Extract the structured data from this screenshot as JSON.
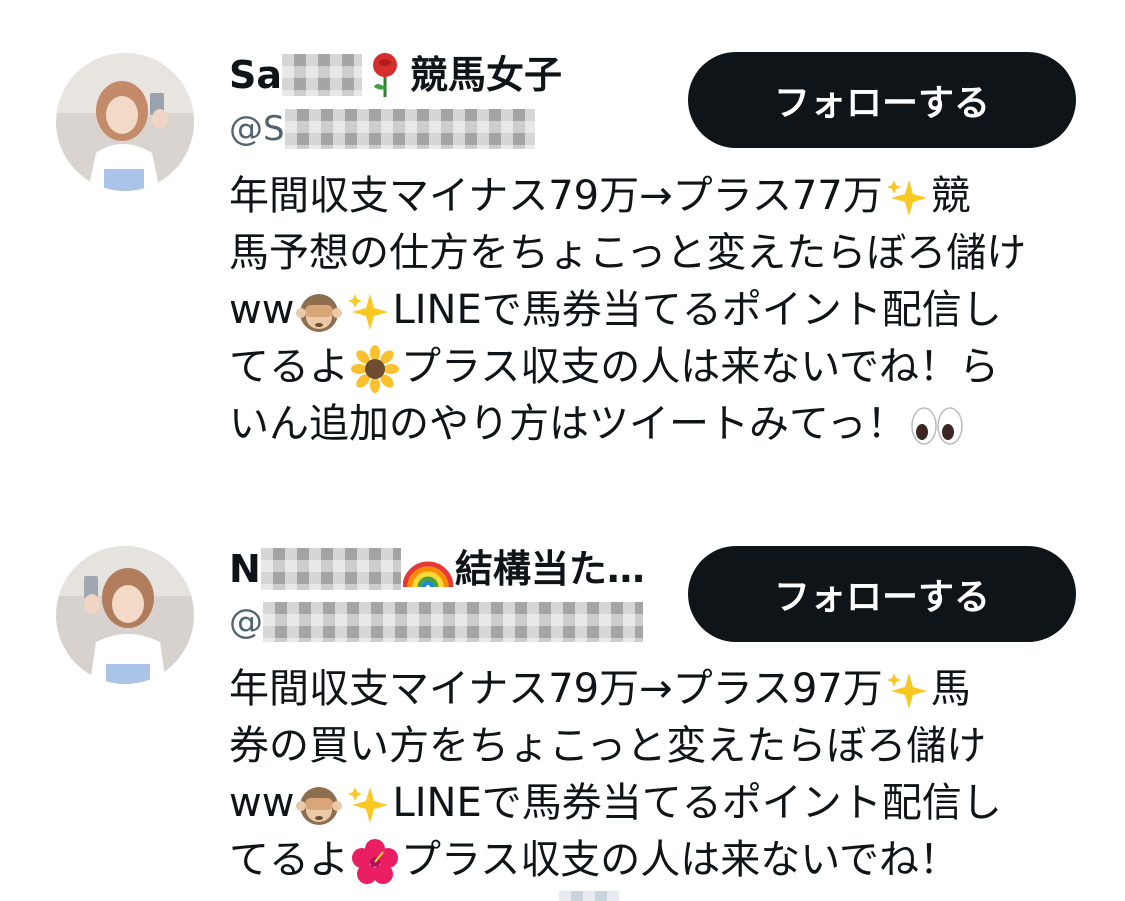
{
  "accounts": [
    {
      "name_visible": "Sa",
      "name_suffix": "競馬女子",
      "name_emoji": "rose",
      "handle_visible": "@S",
      "follow_label": "フォローする",
      "bio_lines": [
        [
          "年間収支マイナス79万→プラス77万",
          "sparkles",
          "競"
        ],
        [
          "馬予想の仕方をちょこっと変えたらぼろ儲け"
        ],
        [
          "ww",
          "see-no-evil-monkey",
          "sparkles",
          "LINEで馬券当てるポイント配信し"
        ],
        [
          "てるよ",
          "sunflower",
          "プラス収支の人は来ないでね！ら"
        ],
        [
          "いん追加のやり方はツイートみてっ！",
          "eyes"
        ]
      ]
    },
    {
      "name_visible": "N",
      "name_suffix": "結構当た…",
      "name_emoji": "rainbow",
      "handle_visible": "@",
      "follow_label": "フォローする",
      "bio_lines": [
        [
          "年間収支マイナス79万→プラス97万",
          "sparkles",
          "馬"
        ],
        [
          "券の買い方をちょこっと変えたらぼろ儲け"
        ],
        [
          "ww",
          "see-no-evil-monkey",
          "sparkles",
          "LINEで馬券当てるポイント配信し"
        ],
        [
          "てるよ",
          "hibiscus",
          "プラス収支の人は来ないでね！"
        ]
      ]
    }
  ],
  "colors": {
    "text": "#0f1419",
    "handle": "#536471",
    "button_bg": "#0f1419",
    "button_text": "#ffffff"
  }
}
